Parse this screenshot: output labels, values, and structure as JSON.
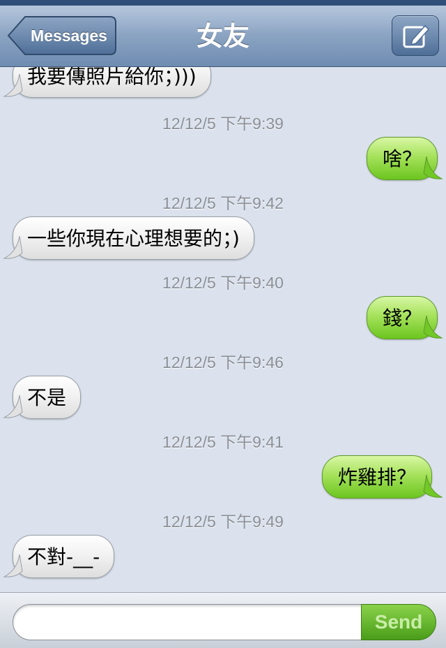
{
  "navbar": {
    "back_label": "Messages",
    "title": "女友",
    "compose_icon": "compose-icon"
  },
  "messages": [
    {
      "type": "bubble",
      "side": "received",
      "text": "我要傳照片給你；)))"
    },
    {
      "type": "timestamp",
      "text": "12/12/5 下午9:39"
    },
    {
      "type": "bubble",
      "side": "sent",
      "text": "啥？"
    },
    {
      "type": "timestamp",
      "text": "12/12/5 下午9:42"
    },
    {
      "type": "bubble",
      "side": "received",
      "text": "一些你現在心理想要的；)"
    },
    {
      "type": "timestamp",
      "text": "12/12/5 下午9:40"
    },
    {
      "type": "bubble",
      "side": "sent",
      "text": "錢？"
    },
    {
      "type": "timestamp",
      "text": "12/12/5 下午9:46"
    },
    {
      "type": "bubble",
      "side": "received",
      "text": "不是"
    },
    {
      "type": "timestamp",
      "text": "12/12/5 下午9:41"
    },
    {
      "type": "bubble",
      "side": "sent",
      "text": "炸雞排？"
    },
    {
      "type": "timestamp",
      "text": "12/12/5 下午9:49"
    },
    {
      "type": "bubble",
      "side": "received",
      "text": "不對-__-"
    }
  ],
  "composer": {
    "input_value": "",
    "send_label": "Send"
  },
  "colors": {
    "navbar": "#8aa3c2",
    "sent_bubble": "#a6e25c",
    "received_bubble": "#f2f2f2",
    "background": "#dbe2ed"
  }
}
